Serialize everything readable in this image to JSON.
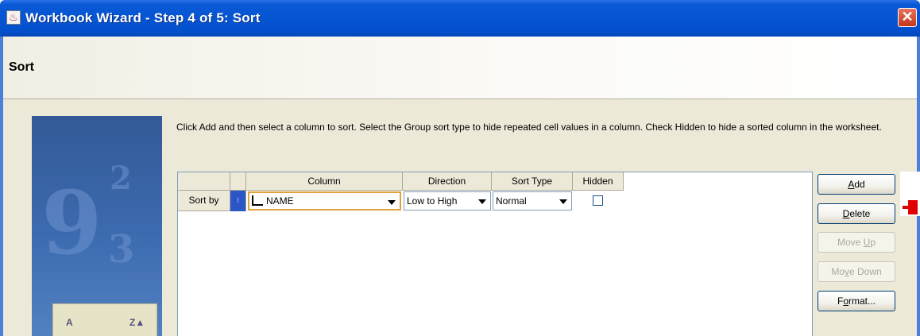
{
  "window": {
    "title": "Workbook Wizard - Step 4 of 5: Sort",
    "close_icon": "close-icon"
  },
  "header": {
    "title": "Sort"
  },
  "instructions": "Click Add and then select a column to sort. Select the Group sort type to hide repeated cell values in a column. Check Hidden to hide a sorted column in the worksheet.",
  "table": {
    "columns": [
      "Column",
      "Direction",
      "Sort Type",
      "Hidden"
    ],
    "rows": [
      {
        "label": "Sort by",
        "column": "NAME",
        "direction": "Low to High",
        "sort_type": "Normal",
        "hidden": false
      }
    ]
  },
  "buttons": {
    "add": {
      "pre": "",
      "key": "A",
      "post": "dd",
      "enabled": true
    },
    "delete": {
      "pre": "",
      "key": "D",
      "post": "elete",
      "enabled": true
    },
    "move_up": {
      "pre": "Move ",
      "key": "U",
      "post": "p",
      "enabled": false
    },
    "move_down": {
      "pre": "Mo",
      "key": "v",
      "post": "e Down",
      "enabled": false
    },
    "format": {
      "pre": "F",
      "key": "o",
      "post": "rmat...",
      "enabled": true
    }
  },
  "colors": {
    "titlebar": "#0555d3",
    "dialog_bg": "#ece9d8",
    "accent_focus": "#e0a23a",
    "selection": "#2a56c6"
  }
}
